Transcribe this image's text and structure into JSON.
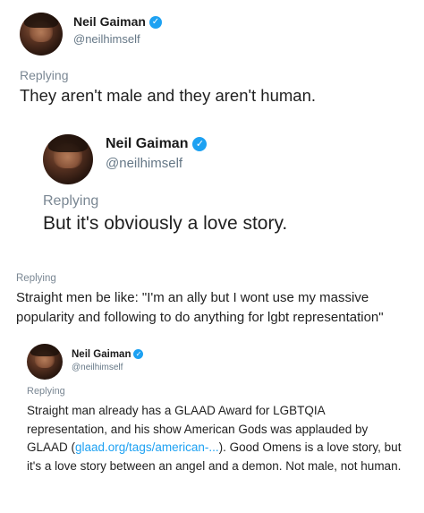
{
  "tweets": [
    {
      "name": "Neil Gaiman",
      "handle": "@neilhimself",
      "replying": "Replying",
      "text": "They aren't male and they aren't human."
    },
    {
      "name": "Neil Gaiman",
      "handle": "@neilhimself",
      "replying": "Replying",
      "text": "But it's obviously a love story."
    },
    {
      "replying": "Replying",
      "text": "Straight men be like: \"I'm an ally but I wont use my massive popularity and following to do anything for lgbt representation\""
    },
    {
      "name": "Neil Gaiman",
      "handle": "@neilhimself",
      "replying": "Replying",
      "text_before_link": "Straight man already has a GLAAD Award for LGBTQIA representation, and his show American Gods was applauded by GLAAD (",
      "link": "glaad.org/tags/american-...",
      "text_after_link": "). Good Omens is a love story, but it's a love story between an angel and a demon. Not male, not human."
    }
  ],
  "icons": {
    "verified": "verified-check-icon",
    "verified_glyph": "✓"
  },
  "colors": {
    "verified_badge": "#1da1f2",
    "link": "#1da1f2",
    "secondary_text": "#657786"
  }
}
